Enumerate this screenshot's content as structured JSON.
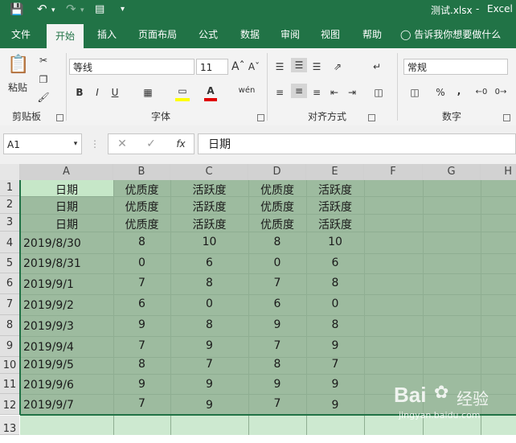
{
  "titlebar": {
    "filename": "测试.xlsx",
    "separator": "-",
    "app": "Excel"
  },
  "tabs": [
    {
      "label": "文件"
    },
    {
      "label": "开始"
    },
    {
      "label": "插入"
    },
    {
      "label": "页面布局"
    },
    {
      "label": "公式"
    },
    {
      "label": "数据"
    },
    {
      "label": "审阅"
    },
    {
      "label": "视图"
    },
    {
      "label": "帮助"
    }
  ],
  "tell_me": "告诉我你想要做什么",
  "ribbon": {
    "clipboard": {
      "paste_label": "粘贴",
      "group_label": "剪贴板"
    },
    "font": {
      "font_name": "等线",
      "font_size": "11",
      "group_label": "字体",
      "bold": "B",
      "italic": "I",
      "underline": "U",
      "phonetic": "wén"
    },
    "alignment": {
      "group_label": "对齐方式"
    },
    "number": {
      "format": "常规",
      "group_label": "数字",
      "percent": "%",
      "comma": ","
    }
  },
  "formula_bar": {
    "name_box": "A1",
    "fx": "fx",
    "content": "日期"
  },
  "columns": [
    "A",
    "B",
    "C",
    "D",
    "E",
    "F",
    "G",
    "H"
  ],
  "rows": [
    "1",
    "2",
    "3",
    "4",
    "5",
    "6",
    "7",
    "8",
    "9",
    "10",
    "11",
    "12",
    "13"
  ],
  "sheet": {
    "headers": [
      [
        "日期",
        "优质度",
        "活跃度",
        "优质度",
        "活跃度"
      ],
      [
        "日期",
        "优质度",
        "活跃度",
        "优质度",
        "活跃度"
      ],
      [
        "日期",
        "优质度",
        "活跃度",
        "优质度",
        "活跃度"
      ]
    ],
    "data": [
      [
        "2019/8/30",
        "8",
        "10",
        "8",
        "10"
      ],
      [
        "2019/8/31",
        "0",
        "6",
        "0",
        "6"
      ],
      [
        "2019/9/1",
        "7",
        "8",
        "7",
        "8"
      ],
      [
        "2019/9/2",
        "6",
        "0",
        "6",
        "0"
      ],
      [
        "2019/9/3",
        "9",
        "8",
        "9",
        "8"
      ],
      [
        "2019/9/4",
        "7",
        "9",
        "7",
        "9"
      ],
      [
        "2019/9/5",
        "8",
        "7",
        "8",
        "7"
      ],
      [
        "2019/9/6",
        "9",
        "9",
        "9",
        "9"
      ],
      [
        "2019/9/7",
        "7",
        "9",
        "7",
        "9"
      ]
    ]
  },
  "watermark": {
    "brand": "Bai",
    "brand2": "经验",
    "url": "jingyan.baidu.com"
  },
  "colors": {
    "excel_green": "#217346",
    "selection_fill": "#9dbb9f",
    "active_cell": "#c6e7c8"
  }
}
